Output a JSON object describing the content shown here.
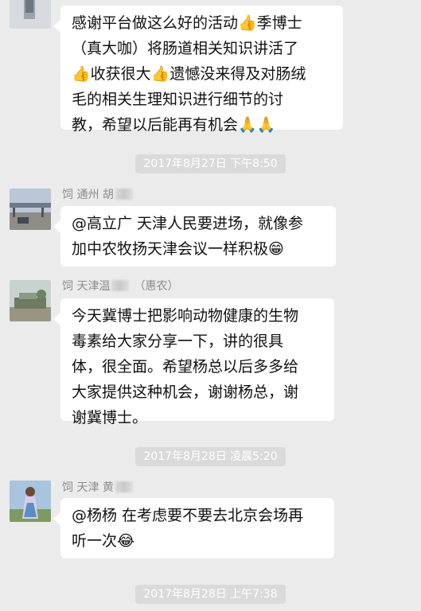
{
  "messages": {
    "msg1": {
      "text": "感谢平台做这么好的活动👍季博士\n（真大咖）将肠道相关知识讲活了\n👍收获很大👍遗憾没来得及对肠绒\n毛的相关生理知识进行细节的讨\n教，希望以后能再有机会🙏🙏"
    },
    "time1": "2017年8月27日 下午8:50",
    "msg2": {
      "sender": "饲 通州 胡",
      "text": "@高立广 天津人民要进场，就像参\n加中农牧扬天津会议一样积极😁"
    },
    "msg3": {
      "sender": "饲 天津温",
      "sender_suffix": "（惠农）",
      "text": "今天冀博士把影响动物健康的生物\n毒素给大家分享一下，讲的很具\n体，很全面。希望杨总以后多多给\n大家提供这种机会，谢谢杨总，谢\n谢冀博士。"
    },
    "time2": "2017年8月28日 凌晨5:20",
    "msg4": {
      "sender": "饲 天津 黄",
      "text": "@杨杨 在考虑要不要去北京会场再\n听一次😂"
    },
    "time3": "2017年8月28日 上午7:38"
  }
}
